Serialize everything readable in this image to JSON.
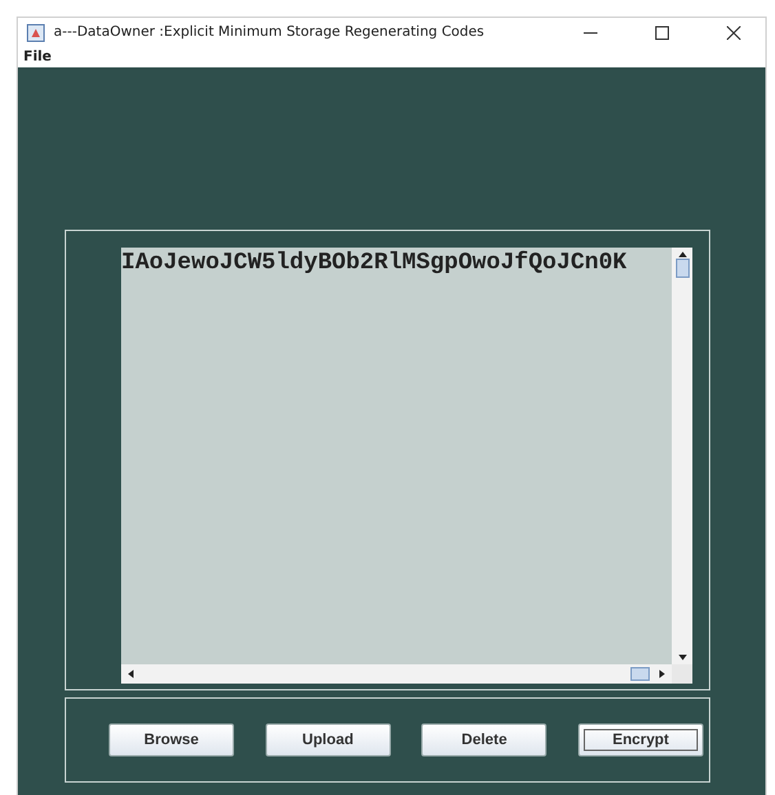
{
  "window": {
    "title": "a---DataOwner :Explicit Minimum Storage Regenerating Codes"
  },
  "menu": [
    "File"
  ],
  "text_area": {
    "value": "IAoJewoJCW5ldyBOb2RlMSgpOwoJfQoJCn0K"
  },
  "buttons": [
    {
      "label": "Browse",
      "focused": false
    },
    {
      "label": "Upload",
      "focused": false
    },
    {
      "label": "Delete",
      "focused": false
    },
    {
      "label": "Encrypt",
      "focused": true
    }
  ]
}
